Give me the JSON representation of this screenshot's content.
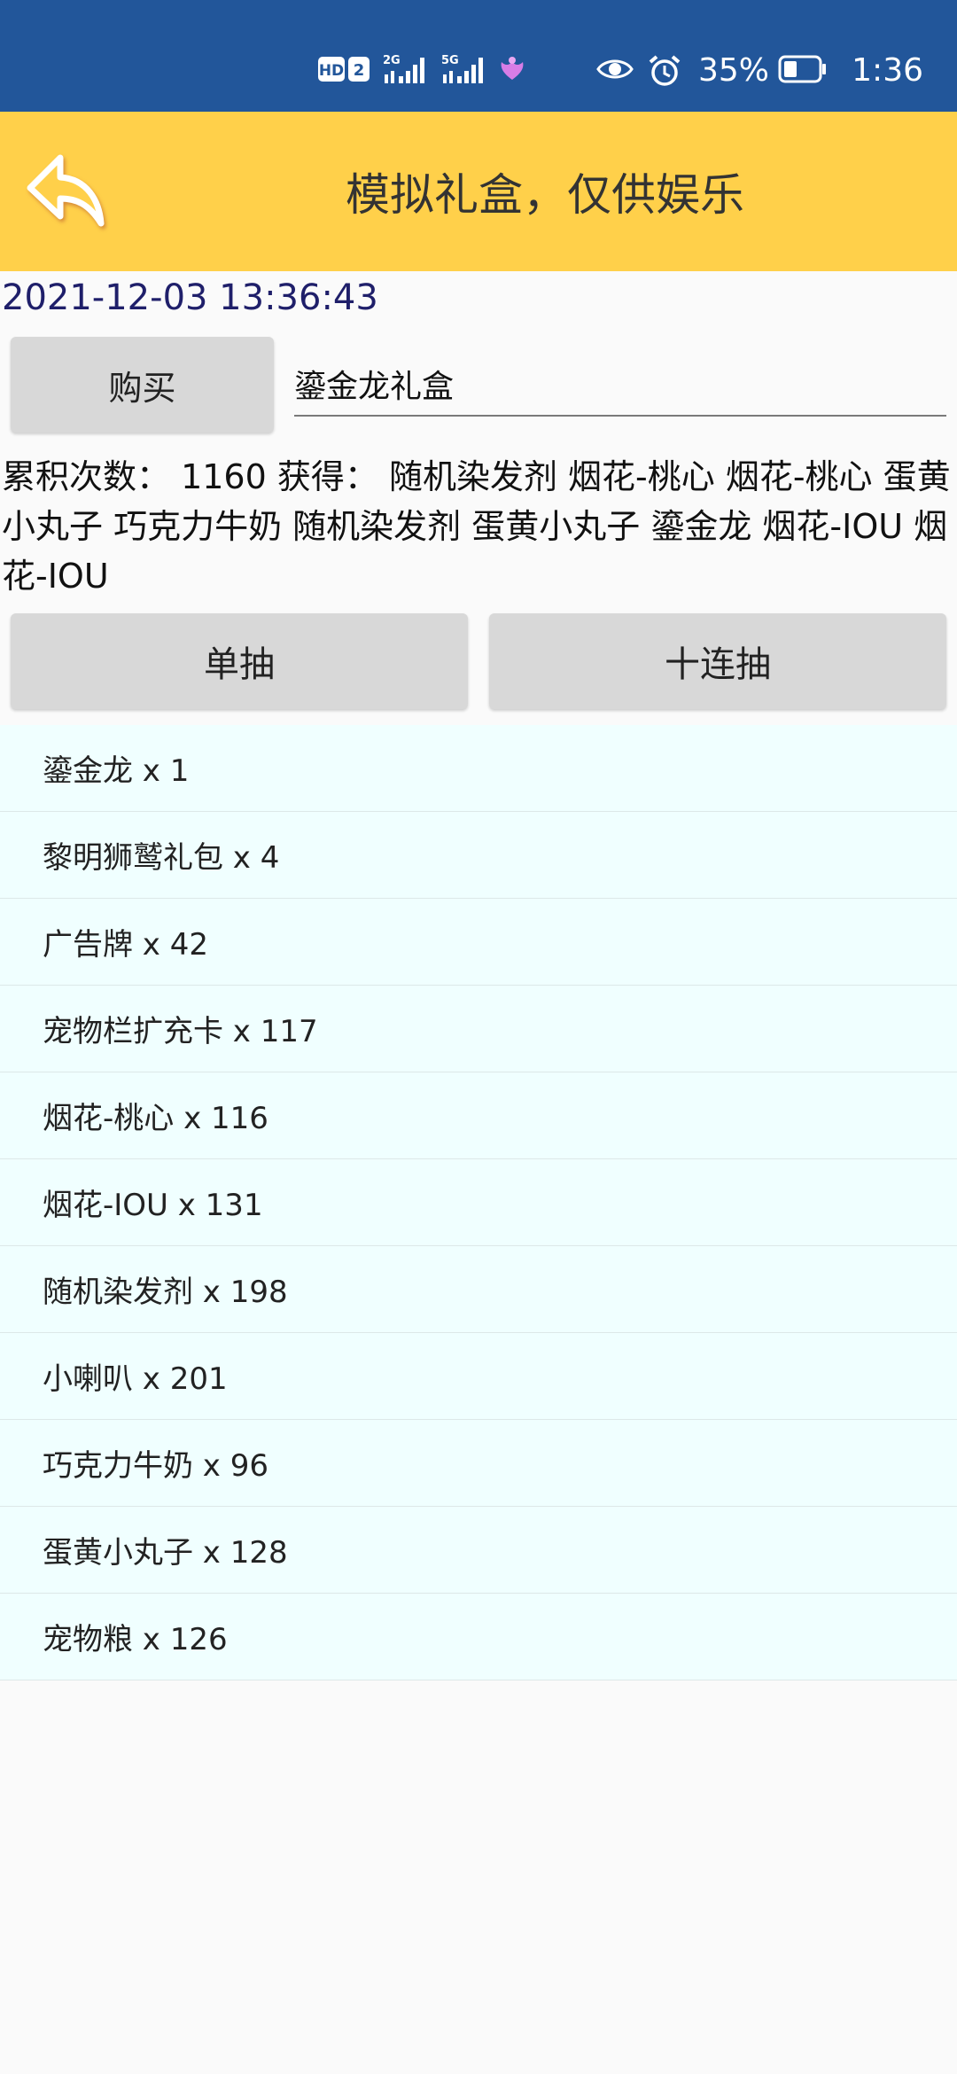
{
  "status_bar": {
    "time": "1:36",
    "battery_percent": "35%",
    "hd_label": "HD",
    "sim_label": "2",
    "signal_1_label": "2G",
    "signal_2_label": "5G"
  },
  "app_bar": {
    "title": "模拟礼盒，仅供娱乐",
    "color": "#ffd04a"
  },
  "datetime": "2021-12-03 13:36:43",
  "buy": {
    "button_label": "购买",
    "box_name": "鎏金龙礼盒"
  },
  "summary": {
    "text": "累积次数： 1160 获得：  随机染发剂 烟花-桃心 烟花-桃心 蛋黄小丸子 巧克力牛奶 随机染发剂 蛋黄小丸子 鎏金龙 烟花-IOU 烟花-IOU"
  },
  "draw": {
    "single_label": "单抽",
    "ten_label": "十连抽"
  },
  "items": [
    {
      "label": "鎏金龙 x 1"
    },
    {
      "label": "黎明狮鹫礼包 x 4"
    },
    {
      "label": "广告牌 x 42"
    },
    {
      "label": "宠物栏扩充卡 x 117"
    },
    {
      "label": "烟花-桃心 x 116"
    },
    {
      "label": "烟花-IOU x 131"
    },
    {
      "label": "随机染发剂 x 198"
    },
    {
      "label": "小喇叭 x 201"
    },
    {
      "label": "巧克力牛奶 x 96"
    },
    {
      "label": "蛋黄小丸子 x 128"
    },
    {
      "label": "宠物粮 x 126"
    }
  ],
  "colors": {
    "status_bar": "#22569a",
    "list_background": "#f0ffff",
    "button_background": "#d8d8d8"
  }
}
